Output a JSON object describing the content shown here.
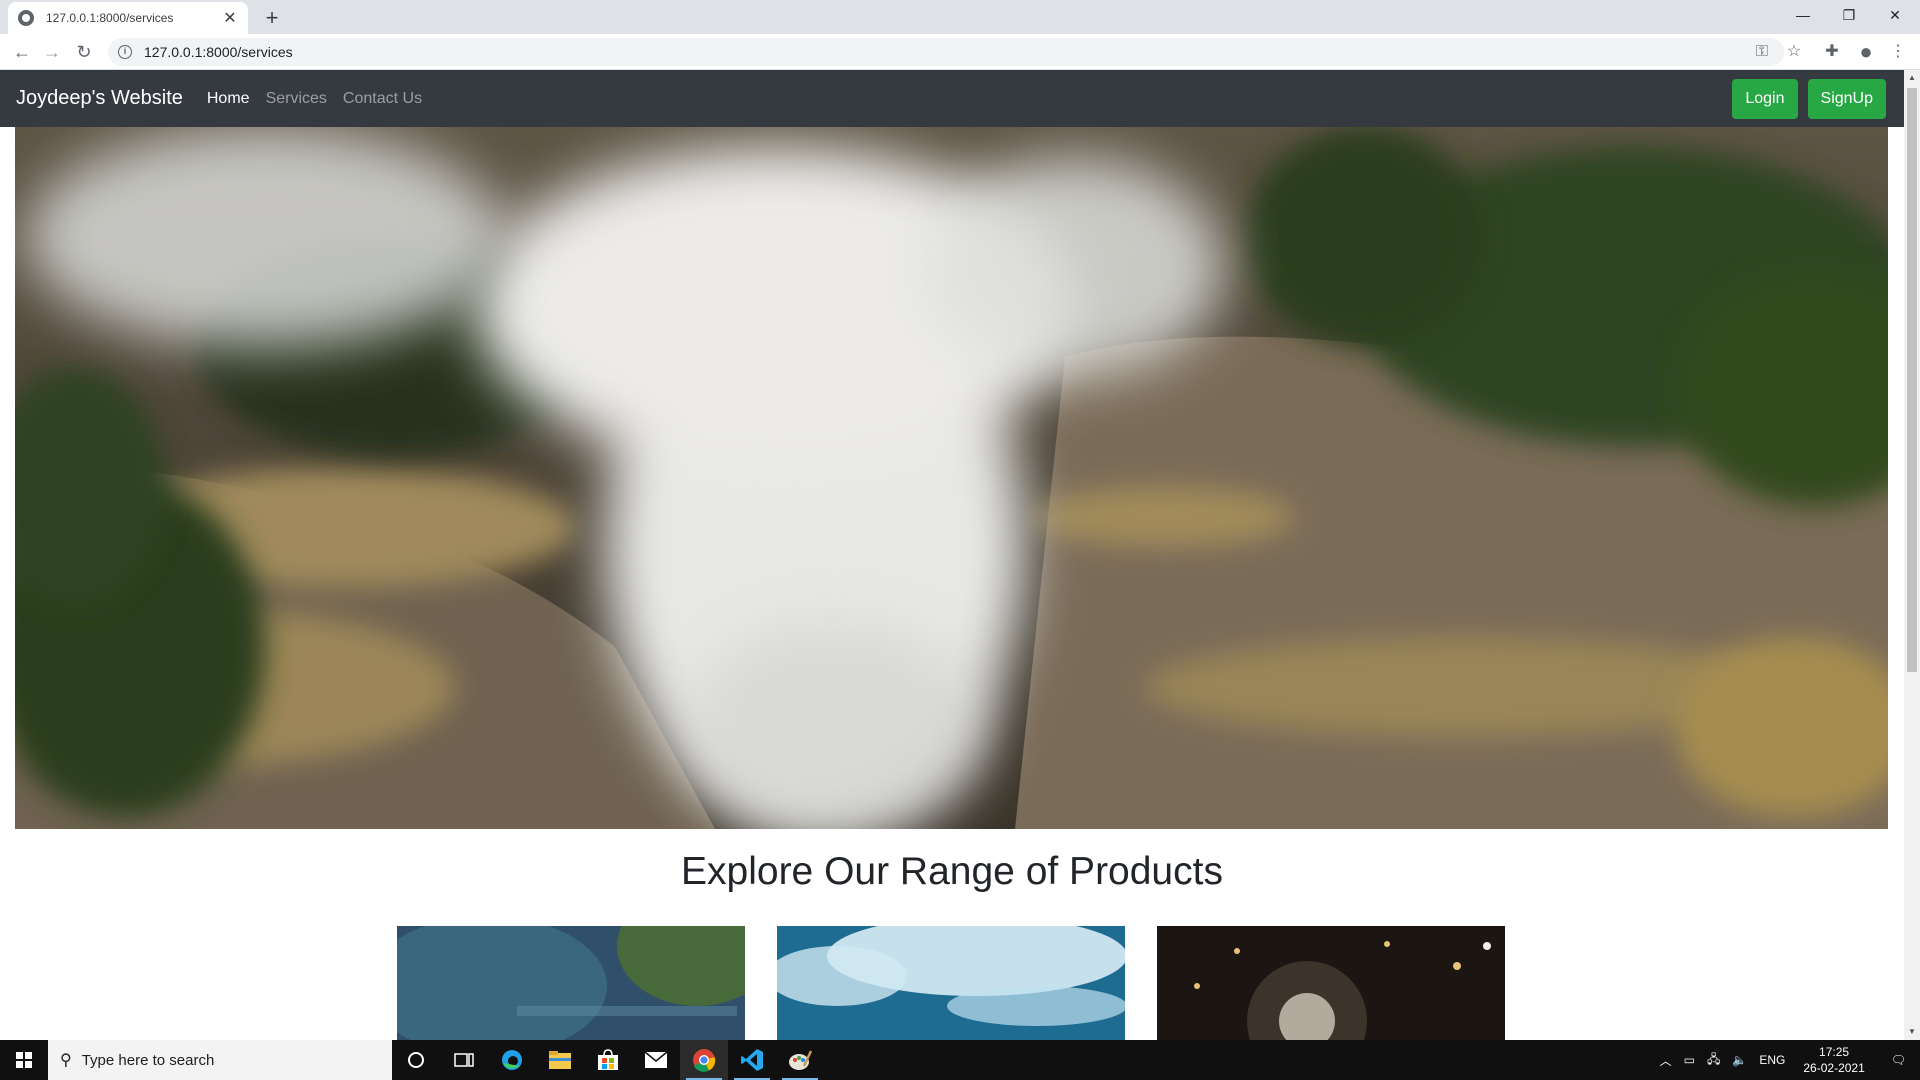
{
  "browser": {
    "tab_title": "127.0.0.1:8000/services",
    "url": "127.0.0.1:8000/services",
    "new_tab": "+",
    "close_tab": "✕",
    "controls": {
      "minimize": "—",
      "restore": "❐",
      "close": "✕"
    }
  },
  "site": {
    "brand": "Joydeep's Website",
    "nav": [
      {
        "label": "Home",
        "active": true
      },
      {
        "label": "Services",
        "active": false
      },
      {
        "label": "Contact Us",
        "active": false
      }
    ],
    "login_label": "Login",
    "signup_label": "SignUp",
    "products_heading": "Explore Our Range of Products"
  },
  "taskbar": {
    "search_placeholder": "Type here to search",
    "language": "ENG",
    "time": "17:25",
    "date": "26-02-2021"
  },
  "colors": {
    "navbar_bg": "#343a40",
    "success": "#28a745",
    "taskbar_bg": "#101010"
  }
}
